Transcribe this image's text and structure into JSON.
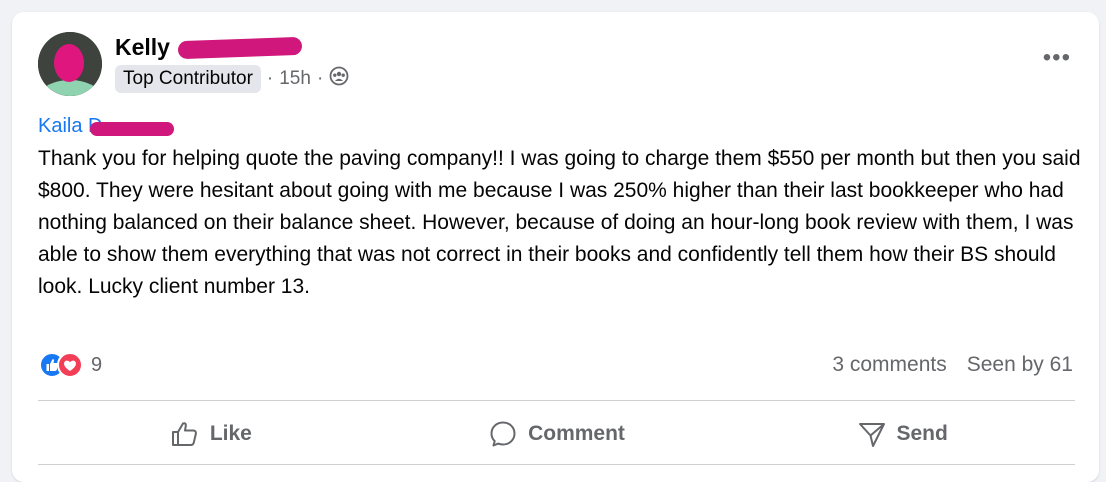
{
  "post": {
    "author": {
      "name": "Kelly",
      "avatar": "avatar-icon"
    },
    "badge": "Top Contributor",
    "separator1": "·",
    "time": "15h",
    "separator2": "·",
    "audience_icon": "group-icon",
    "more_icon": "•••",
    "mention": "Kaila D",
    "text": "Thank you for helping quote the paving company!! I was going to charge them $550 per month but then you said $800. They were hesitant about going with me because I was 250% higher than their last bookkeeper who had nothing balanced on their balance sheet. However, because of doing an hour-long book review with them, I was able to show them everything that was not correct in their books and confidently tell them how their BS should look. Lucky client number 13.",
    "reaction_count": "9",
    "comments": "3 comments",
    "seen_by": "Seen by 61"
  },
  "actions": {
    "like": "Like",
    "comment": "Comment",
    "send": "Send"
  },
  "colors": {
    "link": "#1877f2",
    "redaction": "#d0177b",
    "like_blue": "#1877f2",
    "love_red": "#f33e58"
  }
}
